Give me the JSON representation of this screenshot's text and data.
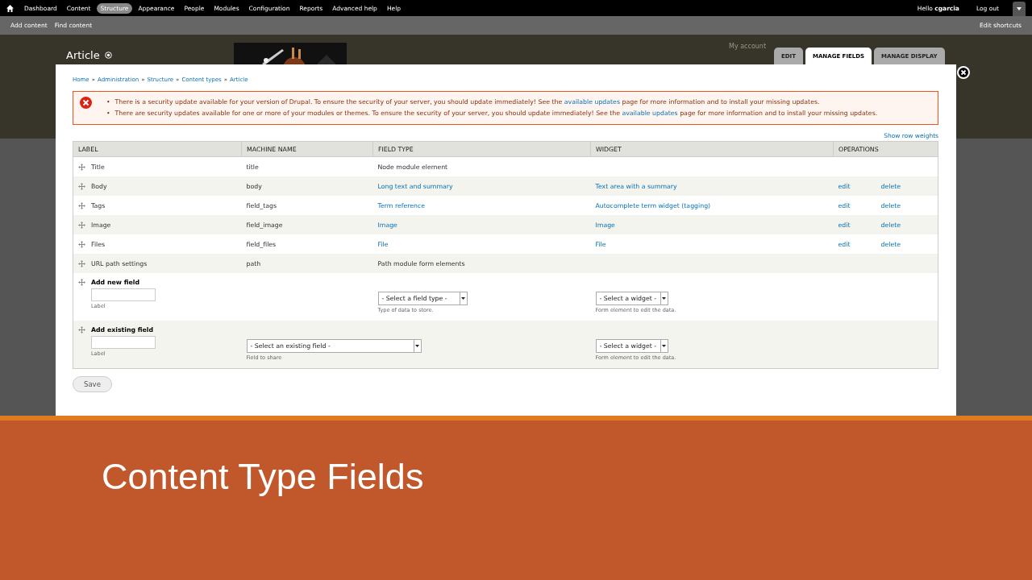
{
  "toolbar": {
    "items": [
      {
        "label": "Dashboard",
        "selected": false
      },
      {
        "label": "Content",
        "selected": false
      },
      {
        "label": "Structure",
        "selected": true
      },
      {
        "label": "Appearance",
        "selected": false
      },
      {
        "label": "People",
        "selected": false
      },
      {
        "label": "Modules",
        "selected": false
      },
      {
        "label": "Configuration",
        "selected": false
      },
      {
        "label": "Reports",
        "selected": false
      },
      {
        "label": "Advanced help",
        "selected": false
      },
      {
        "label": "Help",
        "selected": false
      }
    ],
    "greeting": "Hello",
    "username": "cgarcia",
    "logout": "Log out"
  },
  "shortcuts": {
    "items": [
      "Add content",
      "Find content"
    ],
    "edit": "Edit shortcuts"
  },
  "header": {
    "title": "Article",
    "my_account": "My account",
    "tabs": [
      {
        "label": "EDIT",
        "selected": false
      },
      {
        "label": "MANAGE FIELDS",
        "selected": true
      },
      {
        "label": "MANAGE DISPLAY",
        "selected": false
      }
    ]
  },
  "breadcrumb": {
    "separator": "»",
    "items": [
      "Home",
      "Administration",
      "Structure",
      "Content types",
      "Article"
    ]
  },
  "message_bullet": "•",
  "messages": [
    {
      "before": "There is a security update available for your version of Drupal. To ensure the security of your server, you should update immediately! See the ",
      "link": "available updates",
      "after": " page for more information and to install your missing updates."
    },
    {
      "before": "There are security updates available for one or more of your modules or themes. To ensure the security of your server, you should update immediately! See the ",
      "link": "available updates",
      "after": " page for more information and to install your missing updates."
    }
  ],
  "show_row_weights": "Show row weights",
  "table": {
    "columns": [
      "LABEL",
      "MACHINE NAME",
      "FIELD TYPE",
      "WIDGET",
      "OPERATIONS"
    ],
    "rows": [
      {
        "label": "Title",
        "machine_name": "title",
        "field_type": "Node module element",
        "field_type_link": false,
        "operations": []
      },
      {
        "label": "Body",
        "machine_name": "body",
        "field_type": "Long text and summary",
        "field_type_link": true,
        "widget": "Text area with a summary",
        "operations": [
          "edit",
          "delete"
        ]
      },
      {
        "label": "Tags",
        "machine_name": "field_tags",
        "field_type": "Term reference",
        "field_type_link": true,
        "widget": "Autocomplete term widget (tagging)",
        "operations": [
          "edit",
          "delete"
        ]
      },
      {
        "label": "Image",
        "machine_name": "field_image",
        "field_type": "Image",
        "field_type_link": true,
        "widget": "Image",
        "operations": [
          "edit",
          "delete"
        ]
      },
      {
        "label": "Files",
        "machine_name": "field_files",
        "field_type": "File",
        "field_type_link": true,
        "widget": "File",
        "operations": [
          "edit",
          "delete"
        ]
      },
      {
        "label": "URL path settings",
        "machine_name": "path",
        "field_type": "Path module form elements",
        "field_type_link": false,
        "operations": []
      }
    ],
    "add_rows": [
      {
        "kind": "new",
        "title": "Add new field",
        "label_hint": "Label",
        "type_select": "- Select a field type -",
        "type_hint": "Type of data to store.",
        "widget_select": "- Select a widget -",
        "widget_hint": "Form element to edit the data."
      },
      {
        "kind": "existing",
        "title": "Add existing field",
        "label_hint": "Label",
        "field_select": "- Select an existing field -",
        "field_hint": "Field to share",
        "widget_select": "- Select a widget -",
        "widget_hint": "Form element to edit the data."
      }
    ]
  },
  "save": "Save",
  "slide_title": "Content Type Fields"
}
